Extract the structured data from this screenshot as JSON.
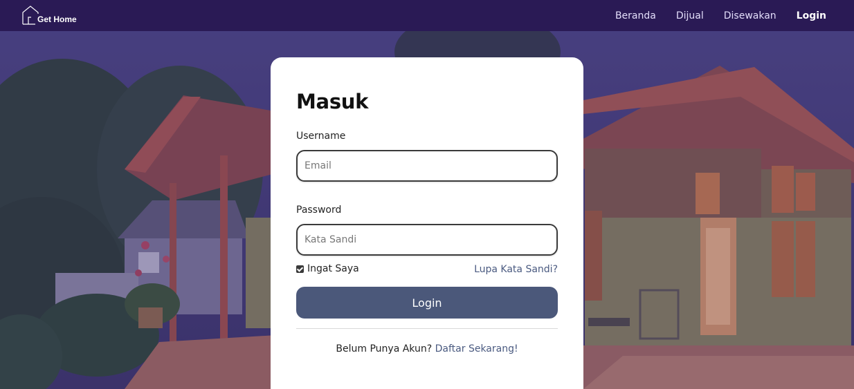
{
  "navbar": {
    "brand": "Get Home",
    "links": [
      "Beranda",
      "Dijual",
      "Disewakan",
      "Login"
    ]
  },
  "form": {
    "title": "Masuk",
    "username_label": "Username",
    "email_placeholder": "Email",
    "password_label": "Password",
    "password_placeholder": "Kata Sandi",
    "remember_label": "Ingat Saya",
    "remember_checked": true,
    "forgot_link": "Lupa Kata Sandi?",
    "login_button": "Login",
    "signup_prompt": "Belum Punya Akun?",
    "signup_link": "Daftar Sekarang!"
  },
  "colors": {
    "navbar": "#2a1a55",
    "button": "#4b587a",
    "link": "#4a5a80"
  }
}
